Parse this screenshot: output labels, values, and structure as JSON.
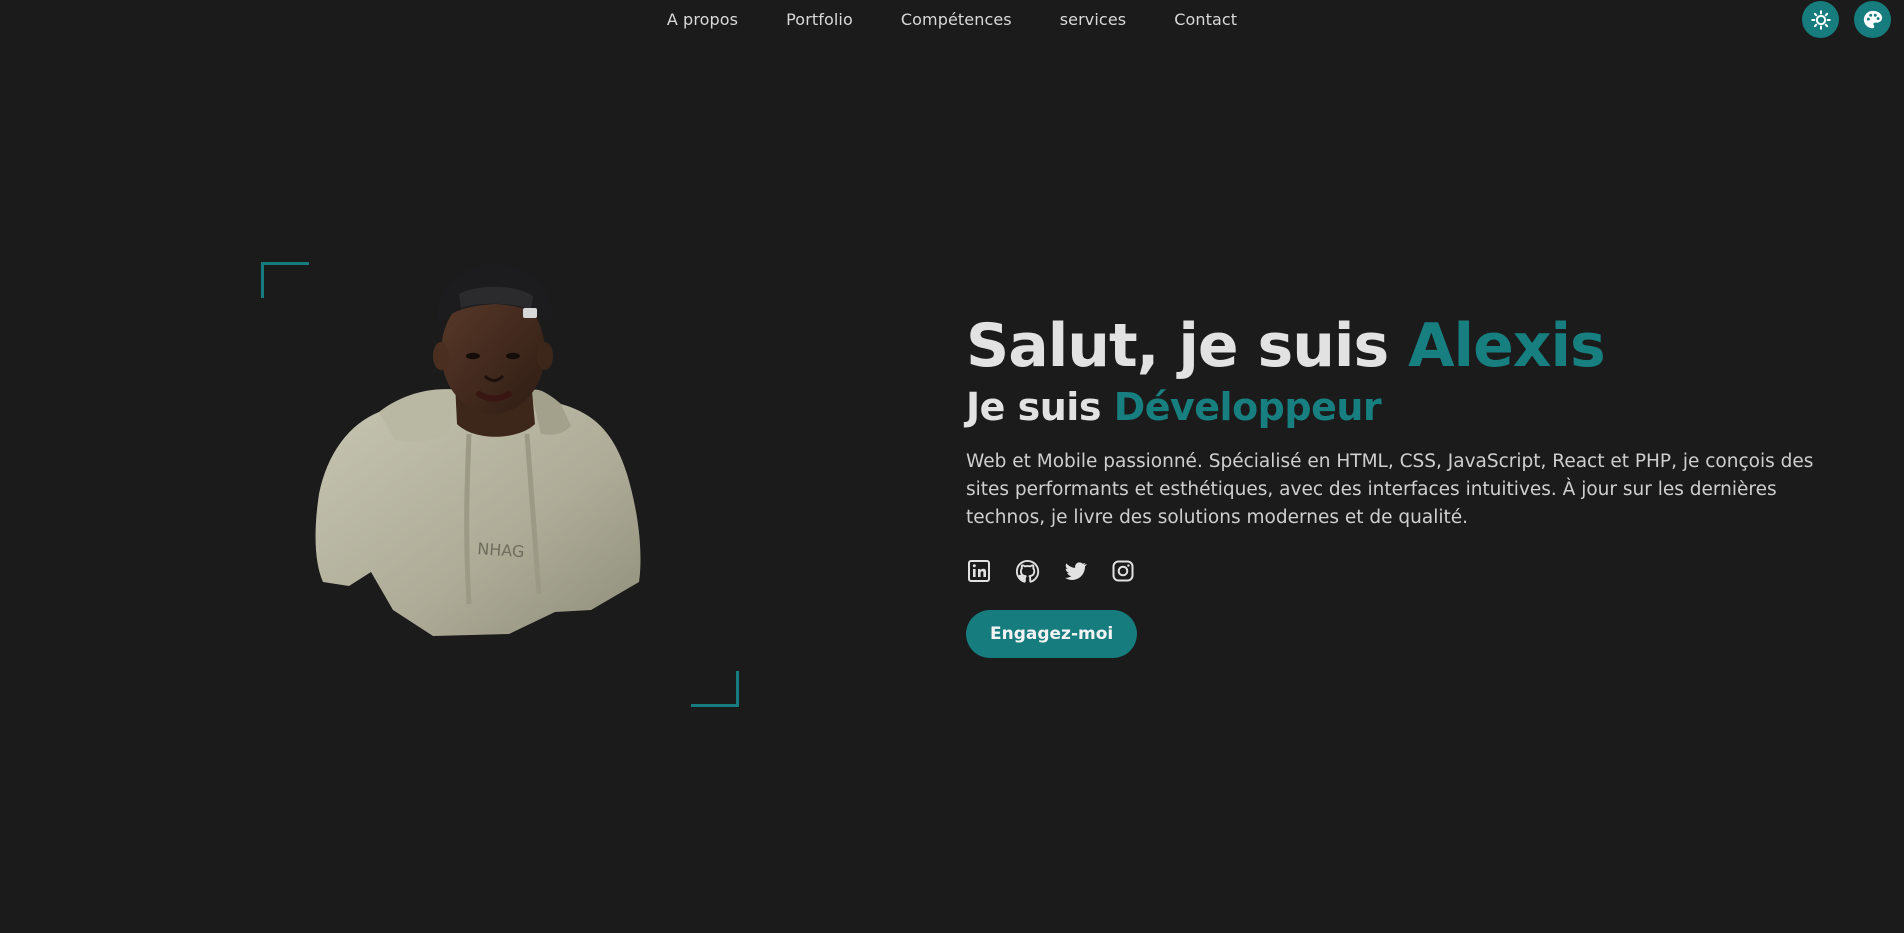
{
  "nav": {
    "links": [
      "A propos",
      "Portfolio",
      "Compétences",
      "services",
      "Contact"
    ],
    "theme_toggle_icon": "sun-icon",
    "palette_icon": "palette-icon"
  },
  "hero": {
    "title_prefix": "Salut, je suis ",
    "title_name": "Alexis",
    "subtitle_prefix": "Je suis ",
    "subtitle_role": "Développeur",
    "description": "Web et Mobile passionné. Spécialisé en HTML, CSS, JavaScript, React et PHP, je conçois des sites performants et esthétiques, avec des interfaces intuitives. À jour sur les dernières technos, je livre des solutions modernes et de qualité.",
    "socials": [
      "linkedin-icon",
      "github-icon",
      "twitter-icon",
      "instagram-icon"
    ],
    "cta_label": "Engagez-moi"
  },
  "colors": {
    "background": "#1b1b1b",
    "accent": "#177f80",
    "text": "#e2e2e2"
  }
}
